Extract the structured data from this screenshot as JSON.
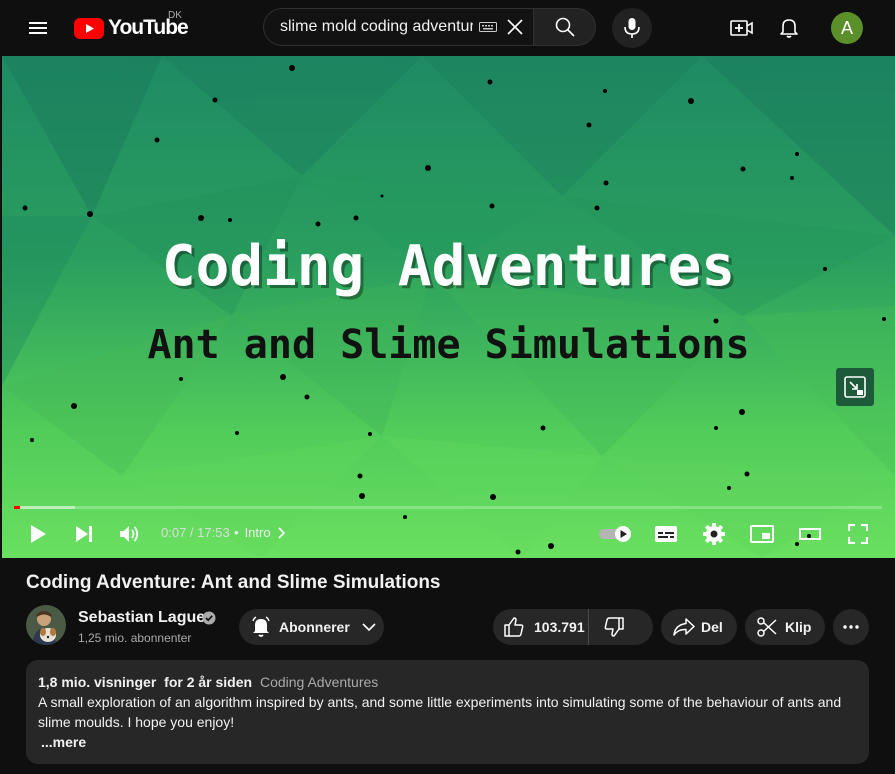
{
  "header": {
    "logo_text": "YouTube",
    "country": "DK",
    "search_value": "slime mold coding adventure",
    "avatar_letter": "A",
    "brand_red": "#ff0000"
  },
  "video": {
    "overlay_title": "Coding Adventures",
    "overlay_subtitle": "Ant and Slime Simulations",
    "time_current": "0:07",
    "time_total": "17:53",
    "time_display": "0:07 / 17:53",
    "chapter": "Intro",
    "progress_fraction": 0.0065,
    "buffer_fraction": 0.07
  },
  "meta": {
    "title": "Coding Adventure: Ant and Slime Simulations",
    "channel_name": "Sebastian Lague",
    "subscribers": "1,25 mio. abonnenter",
    "subscribe_label": "Abonnerer",
    "likes": "103.791",
    "share_label": "Del",
    "clip_label": "Klip"
  },
  "description": {
    "views": "1,8 mio. visninger",
    "age": "for 2 år siden",
    "tag": "Coding Adventures",
    "text": "A small exploration of an algorithm inspired by ants, and some little experiments into simulating some of the behaviour of ants and slime moulds. I hope you enjoy!",
    "more_label": "...mere"
  }
}
